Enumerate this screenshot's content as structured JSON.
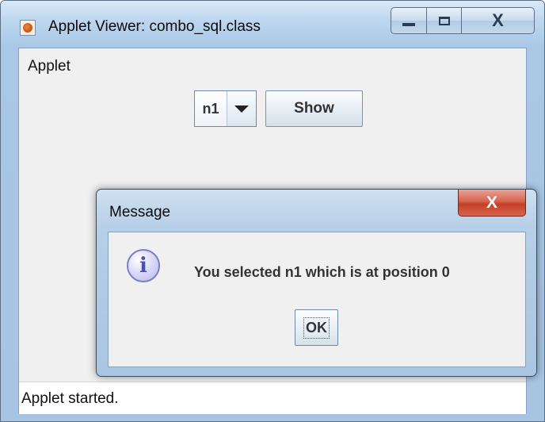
{
  "window": {
    "title": "Applet Viewer: combo_sql.class",
    "title_icon": "java-icon",
    "controls": {
      "minimize": "minimize-icon",
      "maximize": "maximize-icon",
      "close": "close-icon"
    }
  },
  "applet": {
    "menu_label": "Applet",
    "combo": {
      "selected_value": "n1",
      "arrow_icon": "chevron-down-icon"
    },
    "show_button_label": "Show",
    "status_text": "Applet started."
  },
  "dialog": {
    "title": "Message",
    "close_glyph": "X",
    "icon": "info-icon",
    "icon_glyph": "i",
    "message": "You selected n1 which is at position 0",
    "ok_label": "OK"
  },
  "colors": {
    "titlebar": "#a9c7e6",
    "client_background": "#f0f0f0",
    "dialog_close": "#c43f27",
    "info_icon": "#4b50b5"
  }
}
